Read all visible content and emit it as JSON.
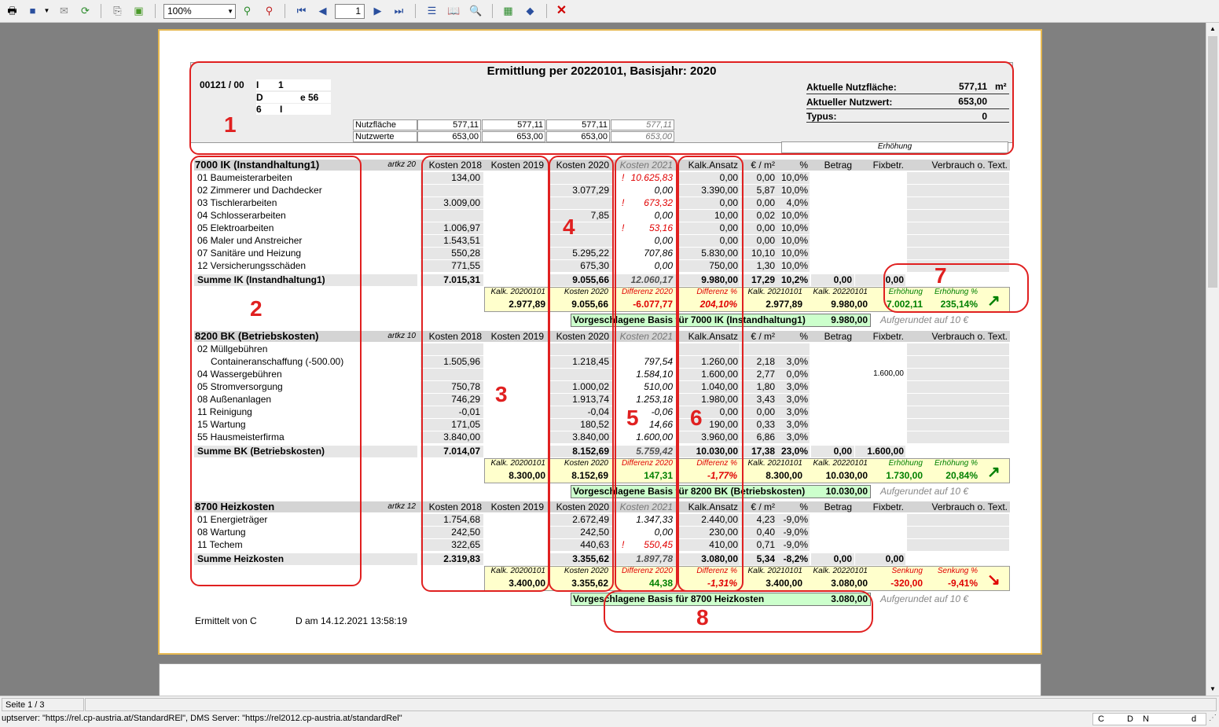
{
  "toolbar": {
    "zoom": "100%",
    "page": "1"
  },
  "status": {
    "page": "Seite 1 / 3",
    "server": "uptserver: \"https://rel.cp-austria.at/StandardREl\", DMS Server: \"https://rel2012.cp-austria.at/standardRel\"",
    "p1": "C",
    "p2": "D",
    "p3": "N",
    "p4": "d"
  },
  "header": {
    "title": "Ermittlung per 20220101, Basisjahr: 2020",
    "id": "00121 / 00",
    "l1": "I",
    "l1b": "1",
    "l2": "D",
    "l2b": "e 56",
    "l3": "6",
    "l3b": "I",
    "nf_label": "Nutzfläche",
    "nw_label": "Nutzwerte",
    "nf": [
      "577,11",
      "577,11",
      "577,11",
      "577,11"
    ],
    "nw": [
      "653,00",
      "653,00",
      "653,00",
      "653,00"
    ],
    "anf_label": "Aktuelle Nutzfläche:",
    "anf": "577,11",
    "anf_unit": "m²",
    "anw_label": "Aktueller Nutzwert:",
    "anw": "653,00",
    "typ_label": "Typus:",
    "typ": "0",
    "erh": "Erhöhung"
  },
  "cols": {
    "k18": "Kosten 2018",
    "k19": "Kosten 2019",
    "k20": "Kosten 2020",
    "k21": "Kosten 2021",
    "ka": "Kalk.Ansatz",
    "em": "€ / m²",
    "pct": "%",
    "betrag": "Betrag",
    "fix": "Fixbetr.",
    "verb": "Verbrauch o. Text."
  },
  "sec1": {
    "name": "7000 IK (Instandhaltung1)",
    "artkz": "artkz 20",
    "rows": [
      {
        "n": "01 Baumeisterarbeiten",
        "k18": "134,00",
        "k20": "",
        "k21": "10.625,83",
        "excl": true,
        "ka": "0,00",
        "em": "0,00",
        "p": "10,0%"
      },
      {
        "n": "02 Zimmerer und Dachdecker",
        "k18": "",
        "k20": "3.077,29",
        "k21": "0,00",
        "ka": "3.390,00",
        "em": "5,87",
        "p": "10,0%"
      },
      {
        "n": "03 Tischlerarbeiten",
        "k18": "3.009,00",
        "k20": "",
        "k21": "673,32",
        "excl": true,
        "ka": "0,00",
        "em": "0,00",
        "p": "4,0%"
      },
      {
        "n": "04 Schlosserarbeiten",
        "k18": "",
        "k20": "7,85",
        "k21": "0,00",
        "ka": "10,00",
        "em": "0,02",
        "p": "10,0%"
      },
      {
        "n": "05 Elektroarbeiten",
        "k18": "1.006,97",
        "k20": "",
        "k21": "53,16",
        "excl": true,
        "ka": "0,00",
        "em": "0,00",
        "p": "10,0%"
      },
      {
        "n": "06 Maler und Anstreicher",
        "k18": "1.543,51",
        "k20": "",
        "k21": "0,00",
        "ka": "0,00",
        "em": "0,00",
        "p": "10,0%"
      },
      {
        "n": "07 Sanitäre und Heizung",
        "k18": "550,28",
        "k20": "5.295,22",
        "k21": "707,86",
        "ka": "5.830,00",
        "em": "10,10",
        "p": "10,0%"
      },
      {
        "n": "12 Versicherungsschäden",
        "k18": "771,55",
        "k20": "675,30",
        "k21": "0,00",
        "ka": "750,00",
        "em": "1,30",
        "p": "10,0%"
      }
    ],
    "sum": {
      "n": "Summe  IK (Instandhaltung1)",
      "k18": "7.015,31",
      "k20": "9.055,66",
      "k21": "12.060,17",
      "ka": "9.980,00",
      "em": "17,29",
      "p": "10,2%",
      "betrag": "0,00",
      "fix": "0,00"
    },
    "box": {
      "l1": "Kalk. 20200101",
      "v1": "2.977,89",
      "l2": "Kosten 2020",
      "v2": "9.055,66",
      "l3": "Differenz 2020",
      "v3": "-6.077,77",
      "l4": "Differenz %",
      "v4": "204,10%",
      "l5": "Kalk. 20210101",
      "v5": "2.977,89",
      "l6": "Kalk. 20220101",
      "v6": "9.980,00",
      "l7": "Erhöhung",
      "v7": "7.002,11",
      "l8": "Erhöhung %",
      "v8": "235,14%",
      "arrow": "↗"
    },
    "basis_label": "Vorgeschlagene Basis für 7000 IK (Instandhaltung1)",
    "basis": "9.980,00",
    "round": "Aufgerundet auf 10 €"
  },
  "sec2": {
    "name": "8200 BK (Betriebskosten)",
    "artkz": "artkz 10",
    "rows": [
      {
        "n": "02 Müllgebühren",
        "k18": "",
        "k20": "",
        "k21": "",
        "ka": "",
        "em": "",
        "p": ""
      },
      {
        "n": "Containeranschaffung (-500.00)",
        "indent": true,
        "k18": "1.505,96",
        "k20": "1.218,45",
        "k21": "797,54",
        "ka": "1.260,00",
        "em": "2,18",
        "p": "3,0%"
      },
      {
        "n": "04 Wassergebühren",
        "k18": "",
        "k20": "",
        "k21": "1.584,10",
        "ka": "1.600,00",
        "em": "2,77",
        "p": "0,0%",
        "fix": "1.600,00"
      },
      {
        "n": "05 Stromversorgung",
        "k18": "750,78",
        "k20": "1.000,02",
        "k21": "510,00",
        "ka": "1.040,00",
        "em": "1,80",
        "p": "3,0%"
      },
      {
        "n": "08 Außenanlagen",
        "k18": "746,29",
        "k20": "1.913,74",
        "k21": "1.253,18",
        "ka": "1.980,00",
        "em": "3,43",
        "p": "3,0%"
      },
      {
        "n": "11 Reinigung",
        "k18": "-0,01",
        "k20": "-0,04",
        "k21": "-0,06",
        "ka": "0,00",
        "em": "0,00",
        "p": "3,0%"
      },
      {
        "n": "15 Wartung",
        "k18": "171,05",
        "k20": "180,52",
        "k21": "14,66",
        "ka": "190,00",
        "em": "0,33",
        "p": "3,0%"
      },
      {
        "n": "55 Hausmeisterfirma",
        "k18": "3.840,00",
        "k20": "3.840,00",
        "k21": "1.600,00",
        "ka": "3.960,00",
        "em": "6,86",
        "p": "3,0%"
      }
    ],
    "sum": {
      "n": "Summe  BK (Betriebskosten)",
      "k18": "7.014,07",
      "k20": "8.152,69",
      "k21": "5.759,42",
      "ka": "10.030,00",
      "em": "17,38",
      "p": "23,0%",
      "betrag": "0,00",
      "fix": "1.600,00"
    },
    "box": {
      "l1": "Kalk. 20200101",
      "v1": "8.300,00",
      "l2": "Kosten 2020",
      "v2": "8.152,69",
      "l3": "Differenz 2020",
      "v3": "147,31",
      "l4": "Differenz %",
      "v4": "-1,77%",
      "l5": "Kalk. 20210101",
      "v5": "8.300,00",
      "l6": "Kalk. 20220101",
      "v6": "10.030,00",
      "l7": "Erhöhung",
      "v7": "1.730,00",
      "l8": "Erhöhung %",
      "v8": "20,84%",
      "arrow": "↗"
    },
    "basis_label": "Vorgeschlagene Basis für 8200 BK (Betriebskosten)",
    "basis": "10.030,00",
    "round": "Aufgerundet auf 10 €"
  },
  "sec3": {
    "name": "8700 Heizkosten",
    "artkz": "artkz 12",
    "rows": [
      {
        "n": "01 Energieträger",
        "k18": "1.754,68",
        "k20": "2.672,49",
        "k21": "1.347,33",
        "ka": "2.440,00",
        "em": "4,23",
        "p": "-9,0%"
      },
      {
        "n": "08 Wartung",
        "k18": "242,50",
        "k20": "242,50",
        "k21": "0,00",
        "ka": "230,00",
        "em": "0,40",
        "p": "-9,0%"
      },
      {
        "n": "11 Techem",
        "k18": "322,65",
        "k20": "440,63",
        "k21": "550,45",
        "excl": true,
        "ka": "410,00",
        "em": "0,71",
        "p": "-9,0%"
      }
    ],
    "sum": {
      "n": "Summe  Heizkosten",
      "k18": "2.319,83",
      "k20": "3.355,62",
      "k21": "1.897,78",
      "ka": "3.080,00",
      "em": "5,34",
      "p": "-8,2%",
      "betrag": "0,00",
      "fix": "0,00"
    },
    "box": {
      "l1": "Kalk. 20200101",
      "v1": "3.400,00",
      "l2": "Kosten 2020",
      "v2": "3.355,62",
      "l3": "Differenz 2020",
      "v3": "44,38",
      "l4": "Differenz %",
      "v4": "-1,31%",
      "l5": "Kalk. 20210101",
      "v5": "3.400,00",
      "l6": "Kalk. 20220101",
      "v6": "3.080,00",
      "l7": "Senkung",
      "v7": "-320,00",
      "l8": "Senkung %",
      "v8": "-9,41%",
      "arrow": "↘"
    },
    "basis_label": "Vorgeschlagene Basis für 8700 Heizkosten",
    "basis": "3.080,00",
    "round": "Aufgerundet auf 10 €"
  },
  "footer": {
    "by": "Ermittelt von C",
    "date": "D am 14.12.2021 13:58:19"
  },
  "annotations": [
    "1",
    "2",
    "3",
    "4",
    "5",
    "6",
    "7",
    "8"
  ]
}
